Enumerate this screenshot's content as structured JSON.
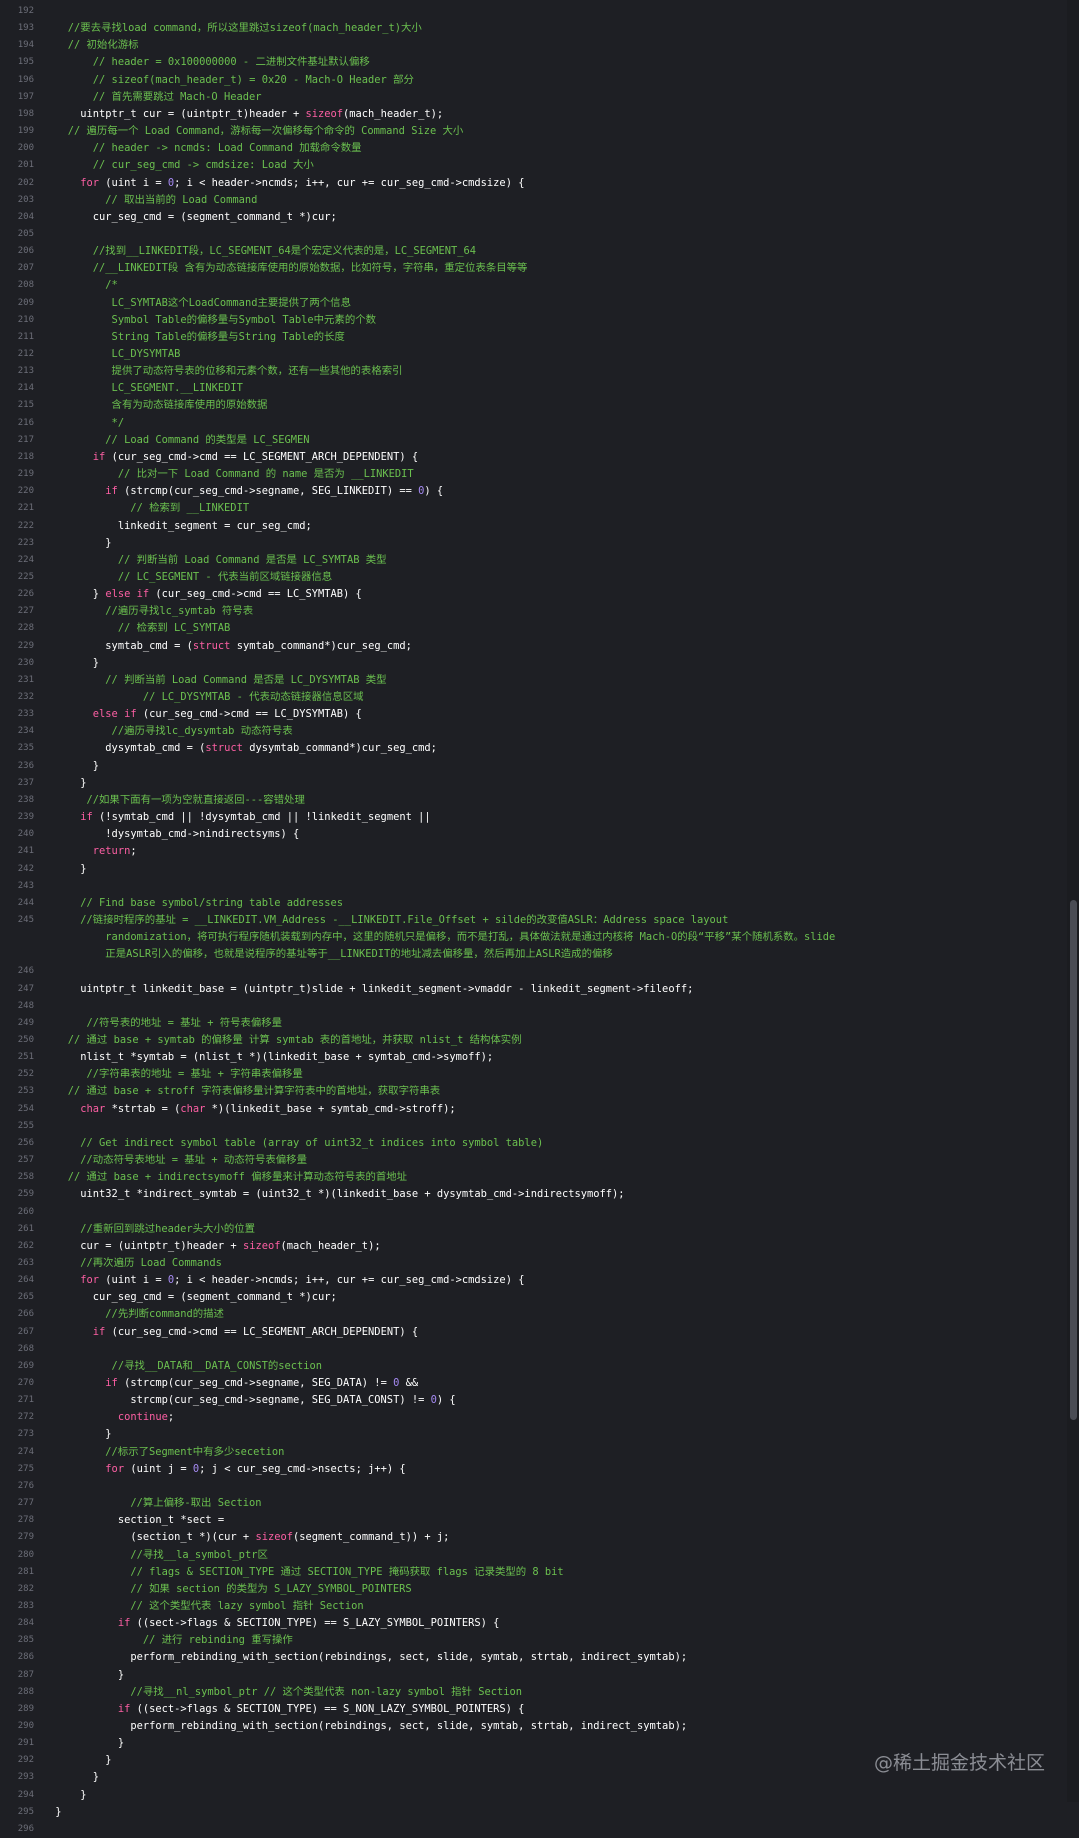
{
  "colors": {
    "background": "#1e1f24",
    "plain": "#ffffff",
    "keyword": "#fc5fa3",
    "comment": "#6bc04f",
    "number": "#a58af2",
    "line_number": "#6c6e78"
  },
  "watermark": "@稀土掘金技术社区",
  "lines": [
    {
      "n": "192",
      "t": []
    },
    {
      "n": "193",
      "t": [
        [
          "c",
          "   //要去寻找load command，所以这里跳过sizeof(mach_header_t)大小"
        ]
      ]
    },
    {
      "n": "194",
      "t": [
        [
          "c",
          "   // 初始化游标"
        ]
      ]
    },
    {
      "n": "195",
      "t": [
        [
          "c",
          "       // header = 0x100000000 - 二进制文件基址默认偏移"
        ]
      ]
    },
    {
      "n": "196",
      "t": [
        [
          "c",
          "       // sizeof(mach_header_t) = 0x20 - Mach-O Header 部分"
        ]
      ]
    },
    {
      "n": "197",
      "t": [
        [
          "c",
          "       // 首先需要跳过 Mach-O Header"
        ]
      ]
    },
    {
      "n": "198",
      "t": [
        [
          "p",
          "     uintptr_t cur = (uintptr_t)header + "
        ],
        [
          "k",
          "sizeof"
        ],
        [
          "p",
          "(mach_header_t);"
        ]
      ]
    },
    {
      "n": "199",
      "t": [
        [
          "c",
          "   // 遍历每一个 Load Command，游标每一次偏移每个命令的 Command Size 大小"
        ]
      ]
    },
    {
      "n": "200",
      "t": [
        [
          "c",
          "       // header -> ncmds: Load Command 加载命令数量"
        ]
      ]
    },
    {
      "n": "201",
      "t": [
        [
          "c",
          "       // cur_seg_cmd -> cmdsize: Load 大小"
        ]
      ]
    },
    {
      "n": "202",
      "t": [
        [
          "k",
          "     for"
        ],
        [
          "p",
          " (uint i = "
        ],
        [
          "n",
          "0"
        ],
        [
          "p",
          "; i < header->ncmds; i++, cur += cur_seg_cmd->cmdsize) {"
        ]
      ]
    },
    {
      "n": "203",
      "t": [
        [
          "c",
          "         // 取出当前的 Load Command"
        ]
      ]
    },
    {
      "n": "204",
      "t": [
        [
          "p",
          "       cur_seg_cmd = (segment_command_t *)cur;"
        ]
      ]
    },
    {
      "n": "205",
      "t": []
    },
    {
      "n": "206",
      "t": [
        [
          "c",
          "       //找到__LINKEDIT段，LC_SEGMENT_64是个宏定义代表的是，LC_SEGMENT_64"
        ]
      ]
    },
    {
      "n": "207",
      "t": [
        [
          "c",
          "       //__LINKEDIT段 含有为动态链接库使用的原始数据，比如符号，字符串，重定位表条目等等"
        ]
      ]
    },
    {
      "n": "208",
      "t": [
        [
          "c",
          "         /*"
        ]
      ]
    },
    {
      "n": "209",
      "t": [
        [
          "c",
          "          LC_SYMTAB这个LoadCommand主要提供了两个信息"
        ]
      ]
    },
    {
      "n": "210",
      "t": [
        [
          "c",
          "          Symbol Table的偏移量与Symbol Table中元素的个数"
        ]
      ]
    },
    {
      "n": "211",
      "t": [
        [
          "c",
          "          String Table的偏移量与String Table的长度"
        ]
      ]
    },
    {
      "n": "212",
      "t": [
        [
          "c",
          "          LC_DYSYMTAB"
        ]
      ]
    },
    {
      "n": "213",
      "t": [
        [
          "c",
          "          提供了动态符号表的位移和元素个数，还有一些其他的表格索引"
        ]
      ]
    },
    {
      "n": "214",
      "t": [
        [
          "c",
          "          LC_SEGMENT.__LINKEDIT"
        ]
      ]
    },
    {
      "n": "215",
      "t": [
        [
          "c",
          "          含有为动态链接库使用的原始数据"
        ]
      ]
    },
    {
      "n": "216",
      "t": [
        [
          "c",
          "          */"
        ]
      ]
    },
    {
      "n": "217",
      "t": [
        [
          "c",
          "         // Load Command 的类型是 LC_SEGMEN"
        ]
      ]
    },
    {
      "n": "218",
      "t": [
        [
          "k",
          "       if"
        ],
        [
          "p",
          " (cur_seg_cmd->cmd == LC_SEGMENT_ARCH_DEPENDENT) {"
        ]
      ]
    },
    {
      "n": "219",
      "t": [
        [
          "c",
          "           // 比对一下 Load Command 的 name 是否为 __LINKEDIT"
        ]
      ]
    },
    {
      "n": "220",
      "t": [
        [
          "k",
          "         if"
        ],
        [
          "p",
          " (strcmp(cur_seg_cmd->segname, SEG_LINKEDIT) == "
        ],
        [
          "n",
          "0"
        ],
        [
          "p",
          ") {"
        ]
      ]
    },
    {
      "n": "221",
      "t": [
        [
          "c",
          "             // 检索到 __LINKEDIT"
        ]
      ]
    },
    {
      "n": "222",
      "t": [
        [
          "p",
          "           linkedit_segment = cur_seg_cmd;"
        ]
      ]
    },
    {
      "n": "223",
      "t": [
        [
          "p",
          "         }"
        ]
      ]
    },
    {
      "n": "224",
      "t": [
        [
          "c",
          "           // 判断当前 Load Command 是否是 LC_SYMTAB 类型"
        ]
      ]
    },
    {
      "n": "225",
      "t": [
        [
          "c",
          "           // LC_SEGMENT - 代表当前区域链接器信息"
        ]
      ]
    },
    {
      "n": "226",
      "t": [
        [
          "p",
          "       } "
        ],
        [
          "k",
          "else if"
        ],
        [
          "p",
          " (cur_seg_cmd->cmd == LC_SYMTAB) {"
        ]
      ]
    },
    {
      "n": "227",
      "t": [
        [
          "c",
          "         //遍历寻找lc_symtab 符号表"
        ]
      ]
    },
    {
      "n": "228",
      "t": [
        [
          "c",
          "           // 检索到 LC_SYMTAB"
        ]
      ]
    },
    {
      "n": "229",
      "t": [
        [
          "p",
          "         symtab_cmd = ("
        ],
        [
          "k",
          "struct"
        ],
        [
          "p",
          " symtab_command*)cur_seg_cmd;"
        ]
      ]
    },
    {
      "n": "230",
      "t": [
        [
          "p",
          "       }"
        ]
      ]
    },
    {
      "n": "231",
      "t": [
        [
          "c",
          "         // 判断当前 Load Command 是否是 LC_DYSYMTAB 类型"
        ]
      ]
    },
    {
      "n": "232",
      "t": [
        [
          "c",
          "               // LC_DYSYMTAB - 代表动态链接器信息区域"
        ]
      ]
    },
    {
      "n": "233",
      "t": [
        [
          "k",
          "       else if"
        ],
        [
          "p",
          " (cur_seg_cmd->cmd == LC_DYSYMTAB) {"
        ]
      ]
    },
    {
      "n": "234",
      "t": [
        [
          "c",
          "          //遍历寻找lc_dysymtab 动态符号表"
        ]
      ]
    },
    {
      "n": "235",
      "t": [
        [
          "p",
          "         dysymtab_cmd = ("
        ],
        [
          "k",
          "struct"
        ],
        [
          "p",
          " dysymtab_command*)cur_seg_cmd;"
        ]
      ]
    },
    {
      "n": "236",
      "t": [
        [
          "p",
          "       }"
        ]
      ]
    },
    {
      "n": "237",
      "t": [
        [
          "p",
          "     }"
        ]
      ]
    },
    {
      "n": "238",
      "t": [
        [
          "c",
          "      //如果下面有一项为空就直接返回---容错处理"
        ]
      ]
    },
    {
      "n": "239",
      "t": [
        [
          "k",
          "     if"
        ],
        [
          "p",
          " (!symtab_cmd || !dysymtab_cmd || !linkedit_segment ||"
        ]
      ]
    },
    {
      "n": "240",
      "t": [
        [
          "p",
          "         !dysymtab_cmd->nindirectsyms) {"
        ]
      ]
    },
    {
      "n": "241",
      "t": [
        [
          "k",
          "       return"
        ],
        [
          "p",
          ";"
        ]
      ]
    },
    {
      "n": "242",
      "t": [
        [
          "p",
          "     }"
        ]
      ]
    },
    {
      "n": "243",
      "t": []
    },
    {
      "n": "244",
      "t": [
        [
          "c",
          "     // Find base symbol/string table addresses"
        ]
      ]
    },
    {
      "n": "245",
      "t": [
        [
          "c",
          "     //链接时程序的基址 = __LINKEDIT.VM_Address -__LINKEDIT.File_Offset + silde的改变值ASLR：Address space layout"
        ]
      ]
    },
    {
      "n": "",
      "t": [
        [
          "c",
          "         randomization，将可执行程序随机装载到内存中，这里的随机只是偏移，而不是打乱，具体做法就是通过内核将 Mach-O的段“平移”某个随机系数。slide"
        ]
      ]
    },
    {
      "n": "",
      "t": [
        [
          "c",
          "         正是ASLR引入的偏移，也就是说程序的基址等于__LINKEDIT的地址减去偏移量，然后再加上ASLR造成的偏移"
        ]
      ]
    },
    {
      "n": "246",
      "t": []
    },
    {
      "n": "247",
      "t": [
        [
          "p",
          "     uintptr_t linkedit_base = (uintptr_t)slide + linkedit_segment->vmaddr - linkedit_segment->fileoff;"
        ]
      ]
    },
    {
      "n": "248",
      "t": []
    },
    {
      "n": "249",
      "t": [
        [
          "c",
          "      //符号表的地址 = 基址 + 符号表偏移量"
        ]
      ]
    },
    {
      "n": "250",
      "t": [
        [
          "c",
          "   // 通过 base + symtab 的偏移量 计算 symtab 表的首地址，并获取 nlist_t 结构体实例"
        ]
      ]
    },
    {
      "n": "251",
      "t": [
        [
          "p",
          "     nlist_t *symtab = (nlist_t *)(linkedit_base + symtab_cmd->symoff);"
        ]
      ]
    },
    {
      "n": "252",
      "t": [
        [
          "c",
          "      //字符串表的地址 = 基址 + 字符串表偏移量"
        ]
      ]
    },
    {
      "n": "253",
      "t": [
        [
          "c",
          "   // 通过 base + stroff 字符表偏移量计算字符表中的首地址，获取字符串表"
        ]
      ]
    },
    {
      "n": "254",
      "t": [
        [
          "k",
          "     char"
        ],
        [
          "p",
          " *strtab = ("
        ],
        [
          "k",
          "char"
        ],
        [
          "p",
          " *)(linkedit_base + symtab_cmd->stroff);"
        ]
      ]
    },
    {
      "n": "255",
      "t": []
    },
    {
      "n": "256",
      "t": [
        [
          "c",
          "     // Get indirect symbol table (array of uint32_t indices into symbol table)"
        ]
      ]
    },
    {
      "n": "257",
      "t": [
        [
          "c",
          "     //动态符号表地址 = 基址 + 动态符号表偏移量"
        ]
      ]
    },
    {
      "n": "258",
      "t": [
        [
          "c",
          "   // 通过 base + indirectsymoff 偏移量来计算动态符号表的首地址"
        ]
      ]
    },
    {
      "n": "259",
      "t": [
        [
          "p",
          "     uint32_t *indirect_symtab = (uint32_t *)(linkedit_base + dysymtab_cmd->indirectsymoff);"
        ]
      ]
    },
    {
      "n": "260",
      "t": []
    },
    {
      "n": "261",
      "t": [
        [
          "c",
          "     //重新回到跳过header头大小的位置"
        ]
      ]
    },
    {
      "n": "262",
      "t": [
        [
          "p",
          "     cur = (uintptr_t)header + "
        ],
        [
          "k",
          "sizeof"
        ],
        [
          "p",
          "(mach_header_t);"
        ]
      ]
    },
    {
      "n": "263",
      "t": [
        [
          "c",
          "     //再次遍历 Load Commands"
        ]
      ]
    },
    {
      "n": "264",
      "t": [
        [
          "k",
          "     for"
        ],
        [
          "p",
          " (uint i = "
        ],
        [
          "n",
          "0"
        ],
        [
          "p",
          "; i < header->ncmds; i++, cur += cur_seg_cmd->cmdsize) {"
        ]
      ]
    },
    {
      "n": "265",
      "t": [
        [
          "p",
          "       cur_seg_cmd = (segment_command_t *)cur;"
        ]
      ]
    },
    {
      "n": "266",
      "t": [
        [
          "c",
          "         //先判断command的描述"
        ]
      ]
    },
    {
      "n": "267",
      "t": [
        [
          "k",
          "       if"
        ],
        [
          "p",
          " (cur_seg_cmd->cmd == LC_SEGMENT_ARCH_DEPENDENT) {"
        ]
      ]
    },
    {
      "n": "268",
      "t": []
    },
    {
      "n": "269",
      "t": [
        [
          "c",
          "          //寻找__DATA和__DATA_CONST的section"
        ]
      ]
    },
    {
      "n": "270",
      "t": [
        [
          "k",
          "         if"
        ],
        [
          "p",
          " (strcmp(cur_seg_cmd->segname, SEG_DATA) != "
        ],
        [
          "n",
          "0"
        ],
        [
          "p",
          " &&"
        ]
      ]
    },
    {
      "n": "271",
      "t": [
        [
          "p",
          "             strcmp(cur_seg_cmd->segname, SEG_DATA_CONST) != "
        ],
        [
          "n",
          "0"
        ],
        [
          "p",
          ") {"
        ]
      ]
    },
    {
      "n": "272",
      "t": [
        [
          "k",
          "           continue"
        ],
        [
          "p",
          ";"
        ]
      ]
    },
    {
      "n": "273",
      "t": [
        [
          "p",
          "         }"
        ]
      ]
    },
    {
      "n": "274",
      "t": [
        [
          "c",
          "         //标示了Segment中有多少secetion"
        ]
      ]
    },
    {
      "n": "275",
      "t": [
        [
          "k",
          "         for"
        ],
        [
          "p",
          " (uint j = "
        ],
        [
          "n",
          "0"
        ],
        [
          "p",
          "; j < cur_seg_cmd->nsects; j++) {"
        ]
      ]
    },
    {
      "n": "276",
      "t": []
    },
    {
      "n": "277",
      "t": [
        [
          "c",
          "             //算上偏移-取出 Section"
        ]
      ]
    },
    {
      "n": "278",
      "t": [
        [
          "p",
          "           section_t *sect ="
        ]
      ]
    },
    {
      "n": "279",
      "t": [
        [
          "p",
          "             (section_t *)(cur + "
        ],
        [
          "k",
          "sizeof"
        ],
        [
          "p",
          "(segment_command_t)) + j;"
        ]
      ]
    },
    {
      "n": "280",
      "t": [
        [
          "c",
          "             //寻找__la_symbol_ptr区"
        ]
      ]
    },
    {
      "n": "281",
      "t": [
        [
          "c",
          "             // flags & SECTION_TYPE 通过 SECTION_TYPE 掩码获取 flags 记录类型的 8 bit"
        ]
      ]
    },
    {
      "n": "282",
      "t": [
        [
          "c",
          "             // 如果 section 的类型为 S_LAZY_SYMBOL_POINTERS"
        ]
      ]
    },
    {
      "n": "283",
      "t": [
        [
          "c",
          "             // 这个类型代表 lazy symbol 指针 Section"
        ]
      ]
    },
    {
      "n": "284",
      "t": [
        [
          "k",
          "           if"
        ],
        [
          "p",
          " ((sect->flags & SECTION_TYPE) == S_LAZY_SYMBOL_POINTERS) {"
        ]
      ]
    },
    {
      "n": "285",
      "t": [
        [
          "c",
          "               // 进行 rebinding 重写操作"
        ]
      ]
    },
    {
      "n": "286",
      "t": [
        [
          "p",
          "             perform_rebinding_with_section(rebindings, sect, slide, symtab, strtab, indirect_symtab);"
        ]
      ]
    },
    {
      "n": "287",
      "t": [
        [
          "p",
          "           }"
        ]
      ]
    },
    {
      "n": "288",
      "t": [
        [
          "c",
          "             //寻找__nl_symbol_ptr // 这个类型代表 non-lazy symbol 指针 Section"
        ]
      ]
    },
    {
      "n": "289",
      "t": [
        [
          "k",
          "           if"
        ],
        [
          "p",
          " ((sect->flags & SECTION_TYPE) == S_NON_LAZY_SYMBOL_POINTERS) {"
        ]
      ]
    },
    {
      "n": "290",
      "t": [
        [
          "p",
          "             perform_rebinding_with_section(rebindings, sect, slide, symtab, strtab, indirect_symtab);"
        ]
      ]
    },
    {
      "n": "291",
      "t": [
        [
          "p",
          "           }"
        ]
      ]
    },
    {
      "n": "292",
      "t": [
        [
          "p",
          "         }"
        ]
      ]
    },
    {
      "n": "293",
      "t": [
        [
          "p",
          "       }"
        ]
      ]
    },
    {
      "n": "294",
      "t": [
        [
          "p",
          "     }"
        ]
      ]
    },
    {
      "n": "295",
      "t": [
        [
          "p",
          " }"
        ]
      ]
    },
    {
      "n": "296",
      "t": []
    }
  ]
}
